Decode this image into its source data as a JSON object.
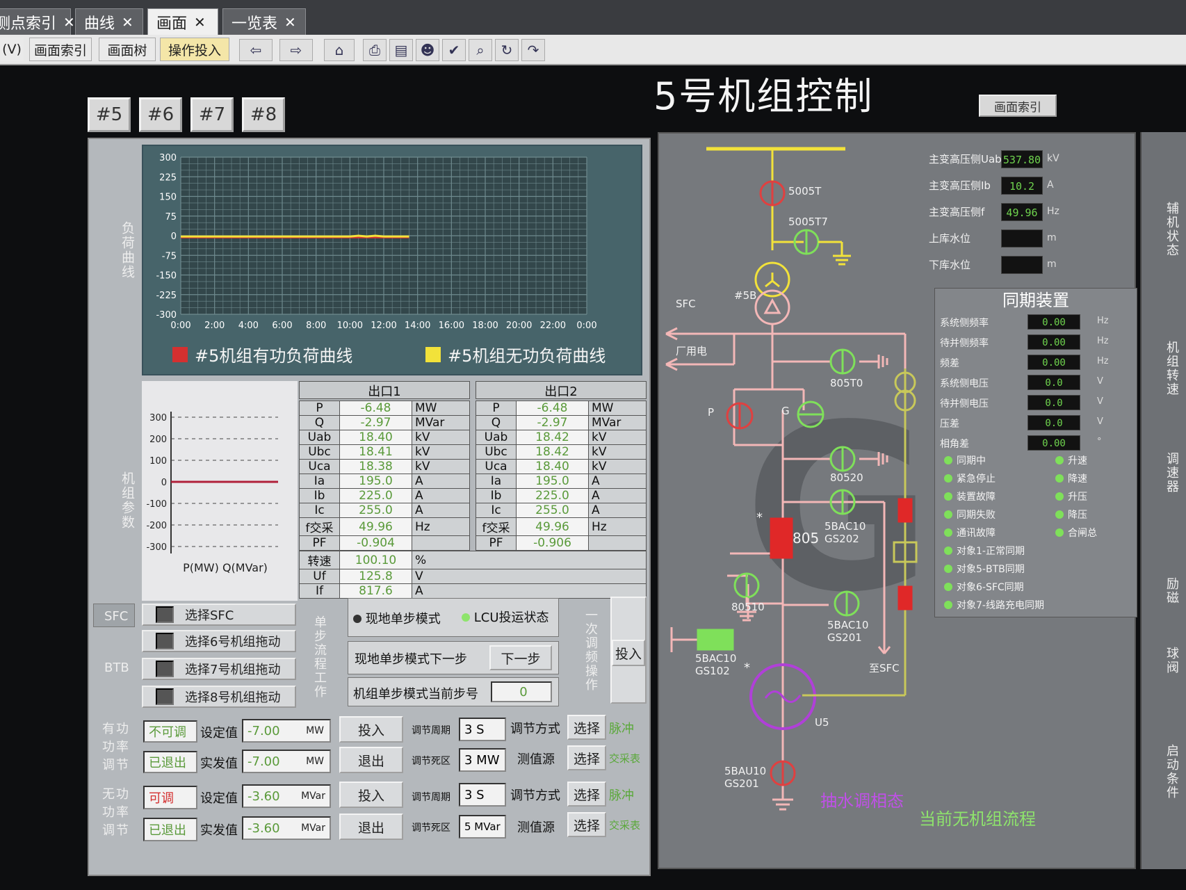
{
  "tabs": [
    {
      "label": "测点索引"
    },
    {
      "label": "曲线"
    },
    {
      "label": "画面"
    },
    {
      "label": "一览表"
    }
  ],
  "toolbar": {
    "menu_v": "(V)",
    "idx": "画面索引",
    "tree": "画面树",
    "op": "操作投入"
  },
  "page_title": "5号机组控制",
  "unit_buttons": [
    "#5",
    "#6",
    "#7",
    "#8"
  ],
  "index_button": "画面索引",
  "sections": {
    "load_curve": "负荷曲线",
    "unit_params": "机组参数",
    "sfc": "SFC",
    "btb": "BTB",
    "single_step": "单步流程工作",
    "primary_freq": "一次调频操作",
    "active_power": "有功功率调节",
    "reactive_power": "无功功率调节"
  },
  "chart_data": {
    "type": "line",
    "x": [
      "0:00",
      "2:00",
      "4:00",
      "6:00",
      "8:00",
      "10:00",
      "12:00",
      "14:00",
      "16:00",
      "18:00",
      "20:00",
      "22:00",
      "0:00"
    ],
    "ylim": [
      -300,
      300
    ],
    "yticks": [
      "300",
      "225",
      "150",
      "75",
      "0",
      "-75",
      "-150",
      "-225",
      "-300"
    ],
    "series": [
      {
        "name": "#5机组有功负荷曲线",
        "color": "#d43030",
        "hours": [
          0,
          2,
          4,
          6,
          8,
          10,
          12,
          13.5
        ],
        "values": [
          -6,
          -6,
          -6,
          -6,
          -6,
          -6,
          -6,
          -6
        ]
      },
      {
        "name": "#5机组无功负荷曲线",
        "color": "#f2e23a",
        "hours": [
          0,
          2,
          4,
          6,
          8,
          10,
          10.5,
          11,
          11.5,
          12,
          13,
          13.5
        ],
        "values": [
          -3,
          -3,
          -3,
          -3,
          -3,
          -3,
          0,
          -3,
          0,
          -3,
          -3,
          -3
        ]
      }
    ]
  },
  "pq_chart": {
    "yticks": [
      "300",
      "200",
      "100",
      "0",
      "-100",
      "-200",
      "-300"
    ],
    "xlabel": "P(MW) Q(MVar)"
  },
  "outlet1": {
    "title": "出口1",
    "rows": [
      {
        "n": "P",
        "v": "-6.48",
        "u": "MW"
      },
      {
        "n": "Q",
        "v": "-2.97",
        "u": "MVar"
      },
      {
        "n": "Uab",
        "v": "18.40",
        "u": "kV"
      },
      {
        "n": "Ubc",
        "v": "18.41",
        "u": "kV"
      },
      {
        "n": "Uca",
        "v": "18.38",
        "u": "kV"
      },
      {
        "n": "Ia",
        "v": "195.0",
        "u": "A"
      },
      {
        "n": "Ib",
        "v": "225.0",
        "u": "A"
      },
      {
        "n": "Ic",
        "v": "255.0",
        "u": "A"
      },
      {
        "n": "f交采",
        "v": "49.96",
        "u": "Hz"
      },
      {
        "n": "PF",
        "v": "-0.904",
        "u": ""
      }
    ]
  },
  "outlet2": {
    "title": "出口2",
    "rows": [
      {
        "n": "P",
        "v": "-6.48",
        "u": "MW"
      },
      {
        "n": "Q",
        "v": "-2.97",
        "u": "MVar"
      },
      {
        "n": "Uab",
        "v": "18.42",
        "u": "kV"
      },
      {
        "n": "Ubc",
        "v": "18.42",
        "u": "kV"
      },
      {
        "n": "Uca",
        "v": "18.40",
        "u": "kV"
      },
      {
        "n": "Ia",
        "v": "195.0",
        "u": "A"
      },
      {
        "n": "Ib",
        "v": "225.0",
        "u": "A"
      },
      {
        "n": "Ic",
        "v": "255.0",
        "u": "A"
      },
      {
        "n": "f交采",
        "v": "49.96",
        "u": "Hz"
      },
      {
        "n": "PF",
        "v": "-0.906",
        "u": ""
      }
    ]
  },
  "extra_rows": [
    {
      "n": "转速",
      "v": "100.10",
      "u": "%"
    },
    {
      "n": "Uf",
      "v": "125.8",
      "u": "V"
    },
    {
      "n": "If",
      "v": "817.6",
      "u": "A"
    }
  ],
  "sfc_select": "选择SFC",
  "btb_selects": [
    "选择6号机组拖动",
    "选择7号机组拖动",
    "选择8号机组拖动"
  ],
  "step": {
    "local_mode": "现地单步模式",
    "lcu_state": "LCU投运状态",
    "next_label": "现地单步模式下一步",
    "next_btn": "下一步",
    "cur_label": "机组单步模式当前步号",
    "cur_val": "0"
  },
  "primary_freq_btn": "投入",
  "active": {
    "status1": "不可调",
    "status2": "已退出",
    "set_label": "设定值",
    "real_label": "实发值",
    "set_val": "-7.00",
    "real_val": "-7.00",
    "unit": "MW",
    "in_btn": "投入",
    "out_btn": "退出",
    "period_label": "调节周期",
    "period_val": "3  S",
    "dead_label": "调节死区",
    "dead_val": "3  MW",
    "mode_label": "调节方式",
    "src_label": "测值源",
    "select": "选择",
    "mode_val": "脉冲",
    "src_val": "交采表"
  },
  "reactive": {
    "status1": "可调",
    "status2": "已退出",
    "set_label": "设定值",
    "real_label": "实发值",
    "set_val": "-3.60",
    "real_val": "-3.60",
    "unit": "MVar",
    "in_btn": "投入",
    "out_btn": "退出",
    "period_label": "调节周期",
    "period_val": "3  S",
    "dead_label": "调节死区",
    "dead_val": "5  MVar",
    "mode_label": "调节方式",
    "src_label": "测值源",
    "select": "选择",
    "mode_val": "脉冲",
    "src_val": "交采表"
  },
  "diagram": {
    "l5005T": "5005T",
    "l5005T7": "5005T7",
    "l5B": "#5B",
    "sfc": "SFC",
    "aux": "厂用电",
    "l805T0": "805T0",
    "p": "P",
    "g": "G",
    "l80520": "80520",
    "l805": "805",
    "bac202": "5BAC10\nGS202",
    "l80510": "80510",
    "bac201": "5BAC10\nGS201",
    "bac102": "5BAC10\nGS102",
    "to_sfc": "至SFC",
    "u5": "U5",
    "bau": "5BAU10\nGS201",
    "star": "*",
    "watermark": "G5",
    "mode_pump": "抽水调相态",
    "no_flow": "当前无机组流程"
  },
  "meas": [
    {
      "label": "主变高压侧Uab",
      "val": "537.80",
      "unit": "kV"
    },
    {
      "label": "主变高压侧Ib",
      "val": "10.2",
      "unit": "A"
    },
    {
      "label": "主变高压侧f",
      "val": "49.96",
      "unit": "Hz"
    },
    {
      "label": "上库水位",
      "val": "",
      "unit": "m"
    },
    {
      "label": "下库水位",
      "val": "",
      "unit": "m"
    }
  ],
  "sync": {
    "title": "同期装置",
    "rows": [
      {
        "label": "系统侧频率",
        "val": "0.00",
        "unit": "Hz"
      },
      {
        "label": "待并侧频率",
        "val": "0.00",
        "unit": "Hz"
      },
      {
        "label": "频差",
        "val": "0.00",
        "unit": "Hz"
      },
      {
        "label": "系统侧电压",
        "val": "0.0",
        "unit": "V"
      },
      {
        "label": "待并侧电压",
        "val": "0.0",
        "unit": "V"
      },
      {
        "label": "压差",
        "val": "0.0",
        "unit": "V"
      },
      {
        "label": "相角差",
        "val": "0.00",
        "unit": "°"
      }
    ],
    "leds_left": [
      "同期中",
      "紧急停止",
      "装置故障",
      "同期失败",
      "通讯故障",
      "对象1-正常同期",
      "对象5-BTB同期",
      "对象6-SFC同期",
      "对象7-线路充电同期"
    ],
    "leds_right": [
      "升速",
      "降速",
      "升压",
      "降压",
      "合闸总"
    ]
  },
  "side": [
    "辅机状态",
    "机组转速",
    "调速器",
    "励磁",
    "球阀",
    "启动条件"
  ]
}
